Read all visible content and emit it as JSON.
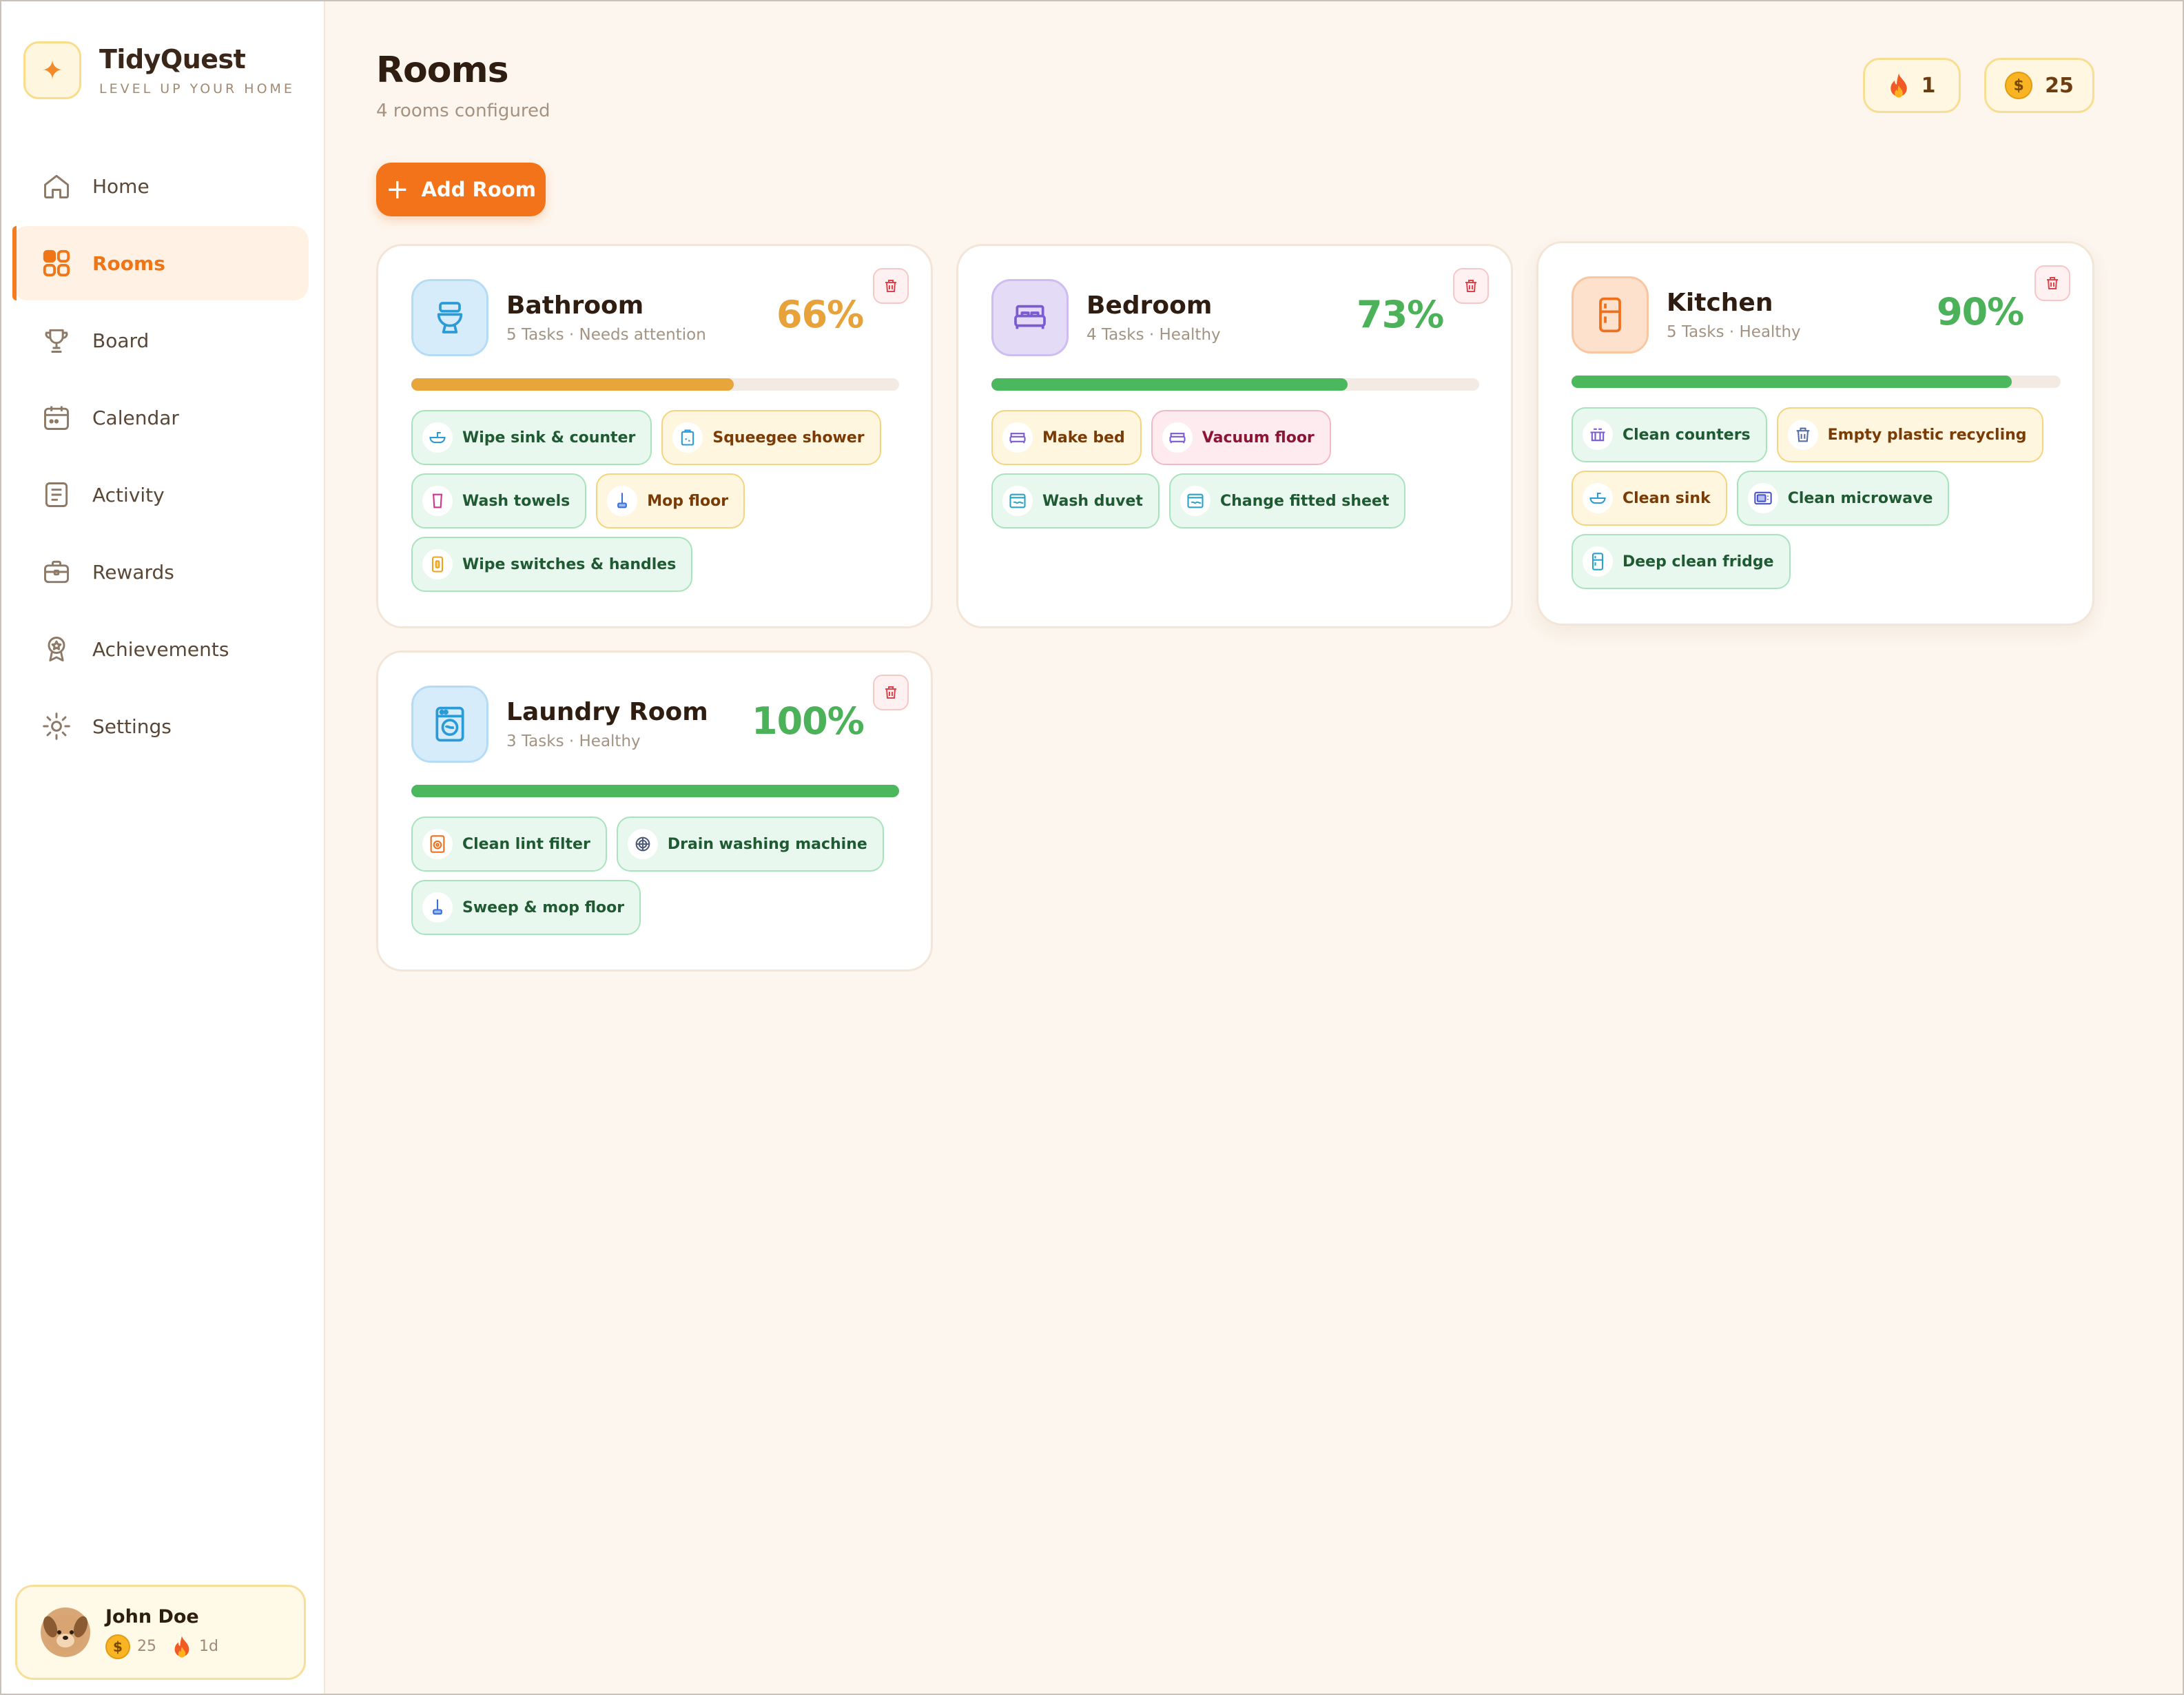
{
  "brand": {
    "title": "TidyQuest",
    "subtitle": "LEVEL UP YOUR HOME",
    "logo_icon": "sparkle-icon"
  },
  "nav": [
    {
      "label": "Home",
      "icon": "home-icon",
      "active": false
    },
    {
      "label": "Rooms",
      "icon": "grid-icon",
      "active": true
    },
    {
      "label": "Board",
      "icon": "trophy-icon",
      "active": false
    },
    {
      "label": "Calendar",
      "icon": "calendar-icon",
      "active": false
    },
    {
      "label": "Activity",
      "icon": "document-icon",
      "active": false
    },
    {
      "label": "Rewards",
      "icon": "gift-box-icon",
      "active": false
    },
    {
      "label": "Achievements",
      "icon": "medal-icon",
      "active": false
    },
    {
      "label": "Settings",
      "icon": "gear-icon",
      "active": false
    }
  ],
  "user": {
    "name": "John Doe",
    "coins": "25",
    "streak": "1d",
    "avatar_icon": "dog-avatar-icon"
  },
  "header": {
    "title": "Rooms",
    "subtitle": "4 rooms configured",
    "streak": "1",
    "coins": "25"
  },
  "actions": {
    "add_room": "Add Room"
  },
  "colors": {
    "accent": "#f3731a",
    "progress_yellow": "#e7a53b",
    "progress_green": "#4cb85e",
    "pct_yellow": "#e8a23a",
    "pct_green": "#4cb25a"
  },
  "rooms": [
    {
      "name": "Bathroom",
      "meta": "5 Tasks · Needs attention",
      "pct": "66%",
      "progress": 0.66,
      "status": "attention",
      "icon": "toilet-icon",
      "tasks": [
        {
          "label": "Wipe sink & counter",
          "icon": "sink-icon",
          "tone": "green"
        },
        {
          "label": "Squeegee shower",
          "icon": "shower-icon",
          "tone": "yellow"
        },
        {
          "label": "Wash towels",
          "icon": "towel-icon",
          "tone": "green"
        },
        {
          "label": "Mop floor",
          "icon": "mop-icon",
          "tone": "yellow"
        },
        {
          "label": "Wipe switches & handles",
          "icon": "switch-icon",
          "tone": "green"
        }
      ]
    },
    {
      "name": "Bedroom",
      "meta": "4 Tasks · Healthy",
      "pct": "73%",
      "progress": 0.73,
      "status": "healthy",
      "icon": "bed-icon",
      "tasks": [
        {
          "label": "Make bed",
          "icon": "bed-icon",
          "tone": "yellow"
        },
        {
          "label": "Vacuum floor",
          "icon": "bed-icon",
          "tone": "red"
        },
        {
          "label": "Wash duvet",
          "icon": "duvet-icon",
          "tone": "green"
        },
        {
          "label": "Change fitted sheet",
          "icon": "sheet-icon",
          "tone": "green"
        }
      ]
    },
    {
      "name": "Kitchen",
      "meta": "5 Tasks · Healthy",
      "pct": "90%",
      "progress": 0.9,
      "status": "healthy",
      "icon": "fridge-icon",
      "tasks": [
        {
          "label": "Clean counters",
          "icon": "counter-icon",
          "tone": "green"
        },
        {
          "label": "Empty plastic recycling",
          "icon": "trash-bin-icon",
          "tone": "yellow"
        },
        {
          "label": "Clean sink",
          "icon": "sink-icon",
          "tone": "yellow"
        },
        {
          "label": "Clean microwave",
          "icon": "microwave-icon",
          "tone": "green"
        },
        {
          "label": "Deep clean fridge",
          "icon": "fridge-icon",
          "tone": "green"
        }
      ]
    },
    {
      "name": "Laundry Room",
      "meta": "3 Tasks · Healthy",
      "pct": "100%",
      "progress": 1.0,
      "status": "healthy",
      "icon": "washing-machine-icon",
      "tasks": [
        {
          "label": "Clean lint filter",
          "icon": "washing-machine-icon",
          "tone": "green"
        },
        {
          "label": "Drain washing machine",
          "icon": "drain-icon",
          "tone": "green"
        },
        {
          "label": "Sweep & mop floor",
          "icon": "mop-icon",
          "tone": "green"
        }
      ]
    }
  ]
}
